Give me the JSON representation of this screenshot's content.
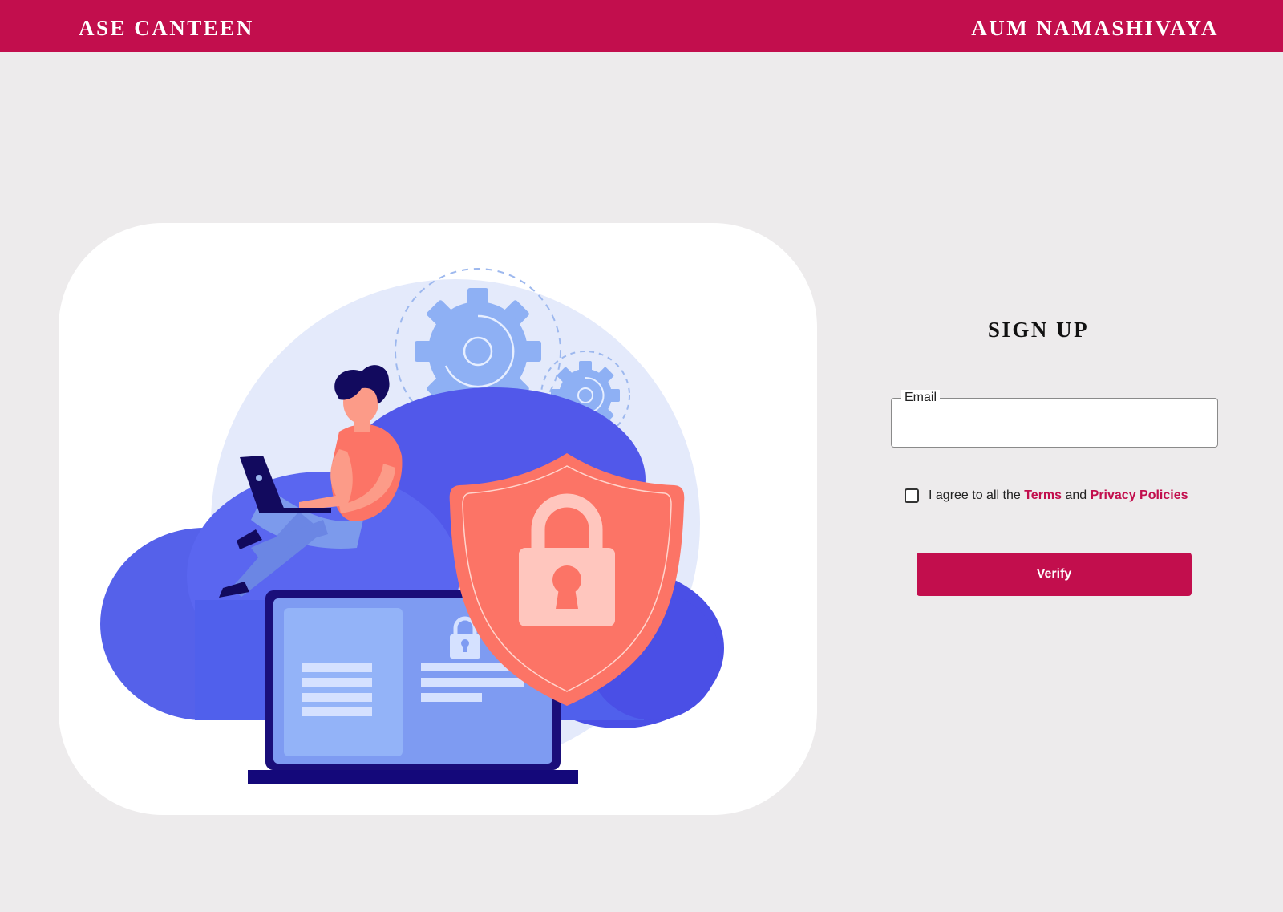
{
  "header": {
    "brand": "ASE CANTEEN",
    "greeting": "AUM NAMASHIVAYA",
    "background_color": "#C20E4D"
  },
  "illustration": {
    "description_icon": "cloud-security-illustration"
  },
  "signup": {
    "title": "SIGN UP",
    "email_label": "Email",
    "email_value": "",
    "agree_prefix": "I agree to all the",
    "terms_link": "Terms",
    "agree_and": "and",
    "privacy_link": "Privacy Policies",
    "verify_label": "Verify",
    "accent_color": "#C20E4D"
  }
}
